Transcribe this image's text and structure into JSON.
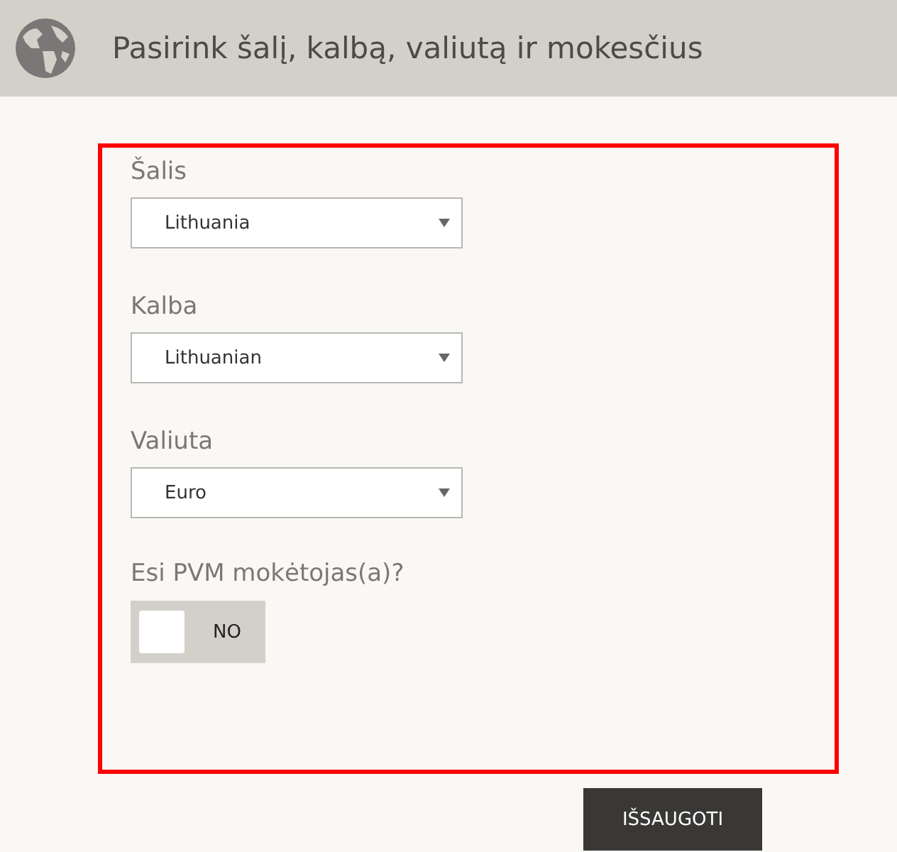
{
  "header": {
    "title": "Pasirink šalį, kalbą, valiutą ir mokesčius"
  },
  "fields": [
    {
      "label": "Šalis",
      "value": "Lithuania"
    },
    {
      "label": "Kalba",
      "value": "Lithuanian"
    },
    {
      "label": "Valiuta",
      "value": "Euro"
    }
  ],
  "vat": {
    "label": "Esi PVM mokėtojas(a)?",
    "on": false,
    "state_text": "NO"
  },
  "save_button": {
    "label": "IŠSAUGOTI"
  }
}
